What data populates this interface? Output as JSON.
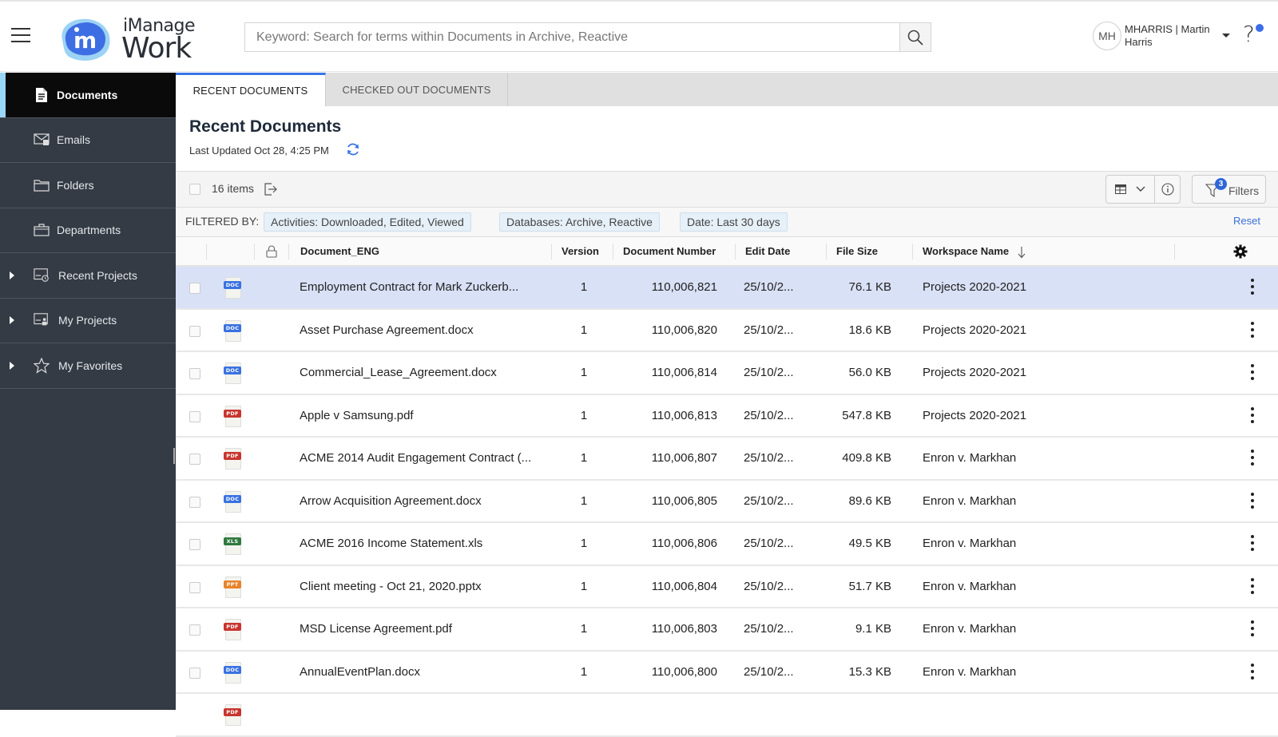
{
  "app": {
    "name_line1": "iManage",
    "name_line2": "Work",
    "logo_letter": "m"
  },
  "search": {
    "placeholder": "Keyword: Search for terms within Documents in Archive, Reactive",
    "value": ""
  },
  "user": {
    "initials": "MH",
    "display": "MHARRIS | Martin Harris"
  },
  "help": {
    "glyph": "?",
    "notification": true
  },
  "sidebar": {
    "items": [
      {
        "label": "Documents",
        "icon": "document-icon",
        "active": true,
        "expandable": false
      },
      {
        "label": "Emails",
        "icon": "email-icon",
        "active": false,
        "expandable": false
      },
      {
        "label": "Folders",
        "icon": "folder-icon",
        "active": false,
        "expandable": false
      },
      {
        "label": "Departments",
        "icon": "briefcase-icon",
        "active": false,
        "expandable": false
      },
      {
        "label": "Recent Projects",
        "icon": "recent-projects-icon",
        "active": false,
        "expandable": true
      },
      {
        "label": "My Projects",
        "icon": "my-projects-icon",
        "active": false,
        "expandable": true
      },
      {
        "label": "My Favorites",
        "icon": "star-icon",
        "active": false,
        "expandable": true
      }
    ]
  },
  "tabs": [
    {
      "label": "RECENT DOCUMENTS",
      "active": true
    },
    {
      "label": "CHECKED OUT DOCUMENTS",
      "active": false
    }
  ],
  "page": {
    "title": "Recent Documents",
    "last_updated": "Last Updated Oct 28, 4:25 PM"
  },
  "toolbar": {
    "items_count": "16 items",
    "filters_label": "Filters",
    "filters_count": "3"
  },
  "filters": {
    "label": "FILTERED BY:",
    "chips": [
      "Activities: Downloaded, Edited, Viewed",
      "Databases: Archive, Reactive",
      "Date: Last 30 days"
    ],
    "reset_label": "Reset"
  },
  "table": {
    "columns": {
      "name": "Document_ENG",
      "version": "Version",
      "number": "Document Number",
      "date": "Edit Date",
      "size": "File Size",
      "workspace": "Workspace Name"
    },
    "sort": {
      "column": "workspace",
      "direction": "descending"
    },
    "file_type_colors": {
      "DOC": "#3a72e0",
      "PDF": "#c8352e",
      "XLS": "#2f7a3e",
      "PPT": "#e8832b"
    },
    "rows": [
      {
        "type": "DOC",
        "name": "Employment Contract for Mark Zuckerb...",
        "version": "1",
        "number": "110,006,821",
        "date": "25/10/2...",
        "size": "76.1 KB",
        "workspace": "Projects 2020-2021",
        "selected": true
      },
      {
        "type": "DOC",
        "name": "Asset Purchase Agreement.docx",
        "version": "1",
        "number": "110,006,820",
        "date": "25/10/2...",
        "size": "18.6 KB",
        "workspace": "Projects 2020-2021",
        "selected": false
      },
      {
        "type": "DOC",
        "name": "Commercial_Lease_Agreement.docx",
        "version": "1",
        "number": "110,006,814",
        "date": "25/10/2...",
        "size": "56.0 KB",
        "workspace": "Projects 2020-2021",
        "selected": false
      },
      {
        "type": "PDF",
        "name": "Apple v Samsung.pdf",
        "version": "1",
        "number": "110,006,813",
        "date": "25/10/2...",
        "size": "547.8 KB",
        "workspace": "Projects 2020-2021",
        "selected": false
      },
      {
        "type": "PDF",
        "name": "ACME 2014 Audit Engagement Contract (...",
        "version": "1",
        "number": "110,006,807",
        "date": "25/10/2...",
        "size": "409.8 KB",
        "workspace": "Enron v. Markhan",
        "selected": false
      },
      {
        "type": "DOC",
        "name": "Arrow Acquisition Agreement.docx",
        "version": "1",
        "number": "110,006,805",
        "date": "25/10/2...",
        "size": "89.6 KB",
        "workspace": "Enron v. Markhan",
        "selected": false
      },
      {
        "type": "XLS",
        "name": "ACME 2016 Income Statement.xls",
        "version": "1",
        "number": "110,006,806",
        "date": "25/10/2...",
        "size": "49.5 KB",
        "workspace": "Enron v. Markhan",
        "selected": false
      },
      {
        "type": "PPT",
        "name": "Client meeting - Oct 21, 2020.pptx",
        "version": "1",
        "number": "110,006,804",
        "date": "25/10/2...",
        "size": "51.7 KB",
        "workspace": "Enron v. Markhan",
        "selected": false
      },
      {
        "type": "PDF",
        "name": "MSD License Agreement.pdf",
        "version": "1",
        "number": "110,006,803",
        "date": "25/10/2...",
        "size": "9.1 KB",
        "workspace": "Enron v. Markhan",
        "selected": false
      },
      {
        "type": "DOC",
        "name": "AnnualEventPlan.docx",
        "version": "1",
        "number": "110,006,800",
        "date": "25/10/2...",
        "size": "15.3 KB",
        "workspace": "Enron v. Markhan",
        "selected": false
      },
      {
        "type": "PDF",
        "name": "",
        "version": "",
        "number": "",
        "date": "",
        "size": "",
        "workspace": "",
        "selected": false
      }
    ]
  }
}
